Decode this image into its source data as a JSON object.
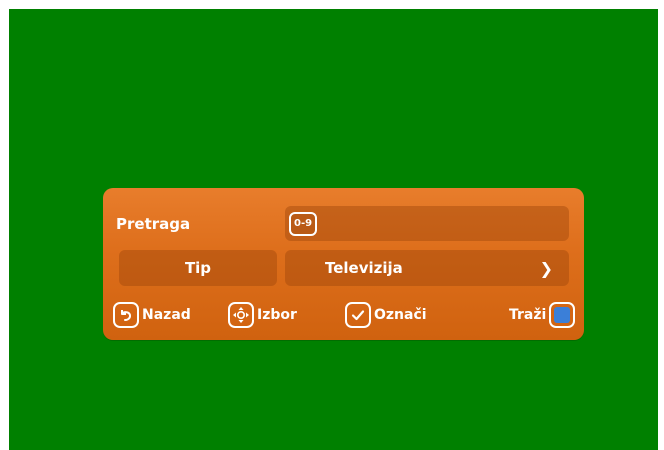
{
  "colors": {
    "background": "#008000",
    "panel": "#e0701e",
    "blue_key": "#3b7fd8"
  },
  "search": {
    "label": "Pretraga",
    "badge": "0-9",
    "value": ""
  },
  "type": {
    "label": "Tip",
    "value": "Televizija",
    "arrow_icon": "chevron-right-icon"
  },
  "hints": {
    "back": {
      "label": "Nazad",
      "icon": "back-arrow-icon"
    },
    "select": {
      "label": "Izbor",
      "icon": "navigate-arrows-icon"
    },
    "mark": {
      "label": "Označi",
      "icon": "checkmark-icon"
    },
    "search": {
      "label": "Traži",
      "icon": "blue-key-icon"
    }
  }
}
